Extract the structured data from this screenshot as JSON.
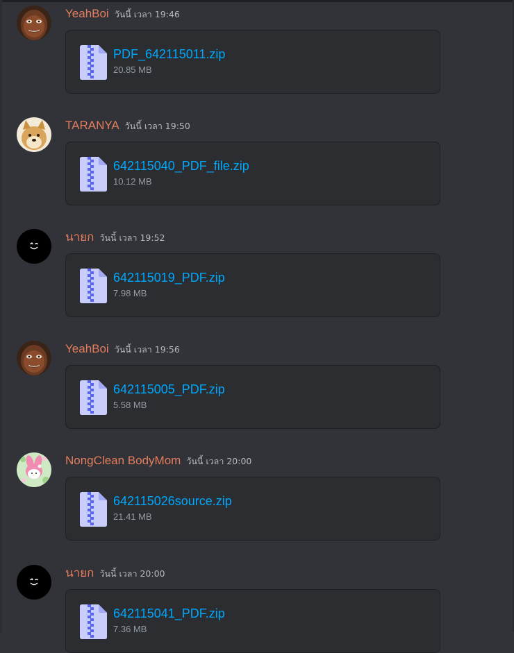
{
  "messages": [
    {
      "username": "YeahBoi",
      "timestamp": "วันนี้ เวลา 19:46",
      "avatar": "meme-face-avatar",
      "file": {
        "name": "PDF_642115011.zip",
        "size": "20.85 MB"
      }
    },
    {
      "username": "TARANYA",
      "timestamp": "วันนี้ เวลา 19:50",
      "avatar": "doge-avatar",
      "file": {
        "name": "642115040_PDF_file.zip",
        "size": "10.12 MB"
      }
    },
    {
      "username": "นายก",
      "timestamp": "วันนี้ เวลา 19:52",
      "avatar": "black-smiley-avatar",
      "file": {
        "name": "642115019_PDF.zip",
        "size": "7.98 MB"
      }
    },
    {
      "username": "YeahBoi",
      "timestamp": "วันนี้ เวลา 19:56",
      "avatar": "meme-face-avatar",
      "file": {
        "name": "642115005_PDF.zip",
        "size": "5.58 MB"
      }
    },
    {
      "username": "NongClean BodyMom",
      "timestamp": "วันนี้ เวลา 20:00",
      "avatar": "my-melody-avatar",
      "file": {
        "name": "642115026source.zip",
        "size": "21.41 MB"
      }
    },
    {
      "username": "นายก",
      "timestamp": "วันนี้ เวลา 20:00",
      "avatar": "black-smiley-avatar",
      "file": {
        "name": "642115041_PDF.zip",
        "size": "7.36 MB"
      }
    }
  ],
  "colors": {
    "background": "#313338",
    "username": "#e57d5d",
    "link": "#00a8fc",
    "attachment_bg": "#2b2d31",
    "file_icon": "#c9cdfb",
    "zipper": "#5865f2"
  }
}
